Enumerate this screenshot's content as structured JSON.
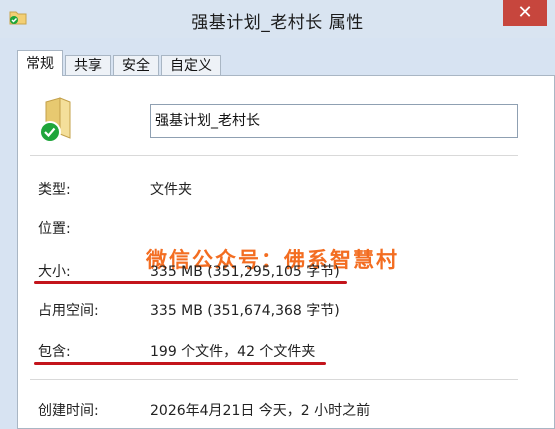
{
  "window": {
    "title": "强基计划_老村长 属性",
    "close_glyph": "✕"
  },
  "tabs": [
    {
      "label": "常规",
      "active": true
    },
    {
      "label": "共享",
      "active": false
    },
    {
      "label": "安全",
      "active": false
    },
    {
      "label": "自定义",
      "active": false
    }
  ],
  "general": {
    "name": "强基计划_老村长",
    "rows": [
      {
        "label": "类型:",
        "value": "文件夹"
      },
      {
        "label": "位置:",
        "value": ""
      },
      {
        "label": "大小:",
        "value": "335 MB (351,295,105 字节)"
      },
      {
        "label": "占用空间:",
        "value": "335 MB (351,674,368 字节)"
      },
      {
        "label": "包含:",
        "value": "199 个文件，42 个文件夹"
      },
      {
        "label": "创建时间:",
        "value": "2026年4月21日 今天，2 小时之前"
      }
    ],
    "watermark": "微信公众号：佛系智慧村"
  },
  "colors": {
    "watermark": "#f36d21",
    "annotation_underline": "#c3141b",
    "close_button": "#c7463d",
    "window_frame": "#d7e3f2"
  },
  "icons": {
    "app": "folder-shared-icon",
    "folder": "folder-with-checkmark-icon"
  }
}
